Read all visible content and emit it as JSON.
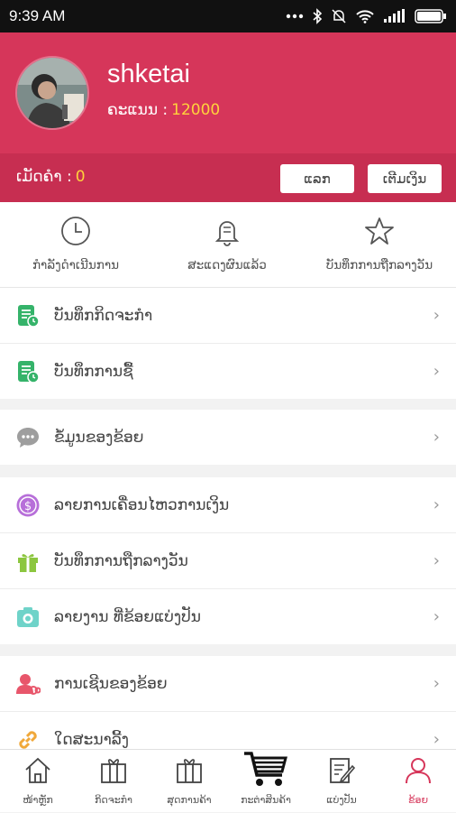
{
  "status_bar": {
    "time": "9:39 AM",
    "icons": [
      "dots-icon",
      "bluetooth-icon",
      "mute-icon",
      "wifi-icon",
      "signal-icon",
      "battery-icon"
    ]
  },
  "profile": {
    "username": "shketai",
    "points_label": "ຄະແນນ :",
    "points_value": "12000",
    "balance_label": "ເມັດຄຳ :",
    "balance_value": "0",
    "exchange_button": "ແລກ",
    "topup_button": "ເຕີມເງິນ"
  },
  "quick_actions": [
    {
      "label": "ກຳລັງດຳເນີນການ",
      "icon": "clock-icon"
    },
    {
      "label": "ສະແດງຜົນແລ້ວ",
      "icon": "bell-icon"
    },
    {
      "label": "ບັນທຶກການຖືກລາງວັນ",
      "icon": "star-icon"
    }
  ],
  "menu_groups": [
    [
      {
        "label": "ບັນທຶກກິດຈະກຳ",
        "icon": "record-icon"
      },
      {
        "label": "ບັນທຶກການຊື້",
        "icon": "purchase-record-icon"
      }
    ],
    [
      {
        "label": "ຂໍ້ມູນຂອງຂ້ອຍ",
        "icon": "chat-icon"
      }
    ],
    [
      {
        "label": "ລາຍການເຄື່ອນໄຫວການເງິນ",
        "icon": "dollar-icon"
      },
      {
        "label": "ບັນທຶກການຖືກລາງວັນ",
        "icon": "gift-icon"
      },
      {
        "label": "ລາຍງານ ທີ່ຂ້ອຍແບ່ງປັນ",
        "icon": "camera-icon"
      }
    ],
    [
      {
        "label": "ການເຊີນຂອງຂ້ອຍ",
        "icon": "invite-icon"
      },
      {
        "label": "ໃດສະນາລີ້ງ",
        "icon": "link-icon"
      }
    ]
  ],
  "colors": {
    "brand": "#d6365a",
    "brand_dark": "#c72e51",
    "highlight": "#ffd23c"
  },
  "bottom_nav": [
    {
      "label": "ໜ້າຫຼັກ",
      "icon": "home-icon",
      "active": false
    },
    {
      "label": "ກິດຈະກຳ",
      "icon": "gift-box-icon",
      "active": false
    },
    {
      "label": "ສຸດການຄ້າ",
      "icon": "gift-box-icon",
      "active": false
    },
    {
      "label": "ກະຕ່າສິນຄ້າ",
      "icon": "cart-icon",
      "active": false
    },
    {
      "label": "ແບ່ງປັນ",
      "icon": "edit-icon",
      "active": false
    },
    {
      "label": "ຂ້ອຍ",
      "icon": "user-icon",
      "active": true
    }
  ]
}
